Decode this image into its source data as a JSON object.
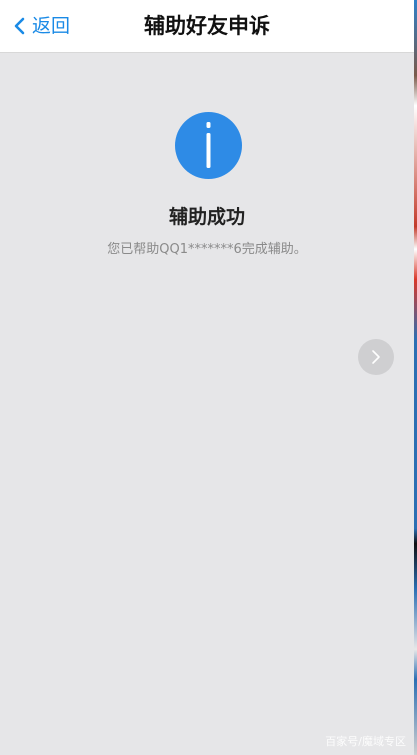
{
  "navbar": {
    "back_label": "返回",
    "title": "辅助好友申诉"
  },
  "result": {
    "icon": "info-icon",
    "title": "辅助成功",
    "description": "您已帮助QQ1*******6完成辅助。"
  },
  "next_button": {
    "icon": "chevron-right-icon"
  },
  "watermark": "百家号/魔域专区",
  "colors": {
    "accent": "#1a8ae6",
    "icon_blue": "#2e8be6",
    "background": "#e6e6e8",
    "navbar": "#ffffff"
  }
}
